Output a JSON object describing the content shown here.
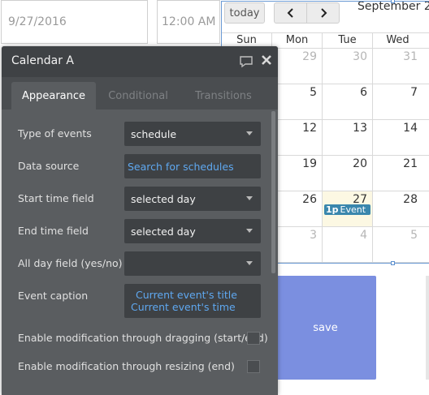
{
  "background": {
    "date_value": "9/27/2016",
    "time_value": "12:00 AM",
    "today_label": "today",
    "month_title": "September 20",
    "weekdays": [
      "Sun",
      "Mon",
      "Tue",
      "Wed"
    ],
    "weeks": [
      [
        "",
        "29",
        "30",
        "31"
      ],
      [
        "",
        "5",
        "6",
        "7"
      ],
      [
        "",
        "12",
        "13",
        "14"
      ],
      [
        "",
        "19",
        "20",
        "21"
      ],
      [
        "",
        "26",
        "27",
        "28"
      ],
      [
        "",
        "3",
        "4",
        "5"
      ]
    ],
    "event": {
      "time": "1p",
      "title": "Event"
    },
    "save_label": "save"
  },
  "panel": {
    "title": "Calendar A",
    "tabs": [
      "Appearance",
      "Conditional",
      "Transitions"
    ],
    "rows": {
      "type_of_events": {
        "label": "Type of events",
        "value": "schedule"
      },
      "data_source": {
        "label": "Data source",
        "value": "Search for schedules"
      },
      "start_time_field": {
        "label": "Start time field",
        "value": "selected day"
      },
      "end_time_field": {
        "label": "End time field",
        "value": "selected day"
      },
      "all_day_field": {
        "label": "All day field (yes/no)",
        "value": ""
      },
      "event_caption": {
        "label": "Event caption",
        "line1": "Current event's title",
        "line2": "Current event's time"
      },
      "drag_mod": {
        "label": "Enable modification through dragging (start/end)"
      },
      "resize_mod": {
        "label": "Enable modification through resizing (end)"
      }
    }
  }
}
